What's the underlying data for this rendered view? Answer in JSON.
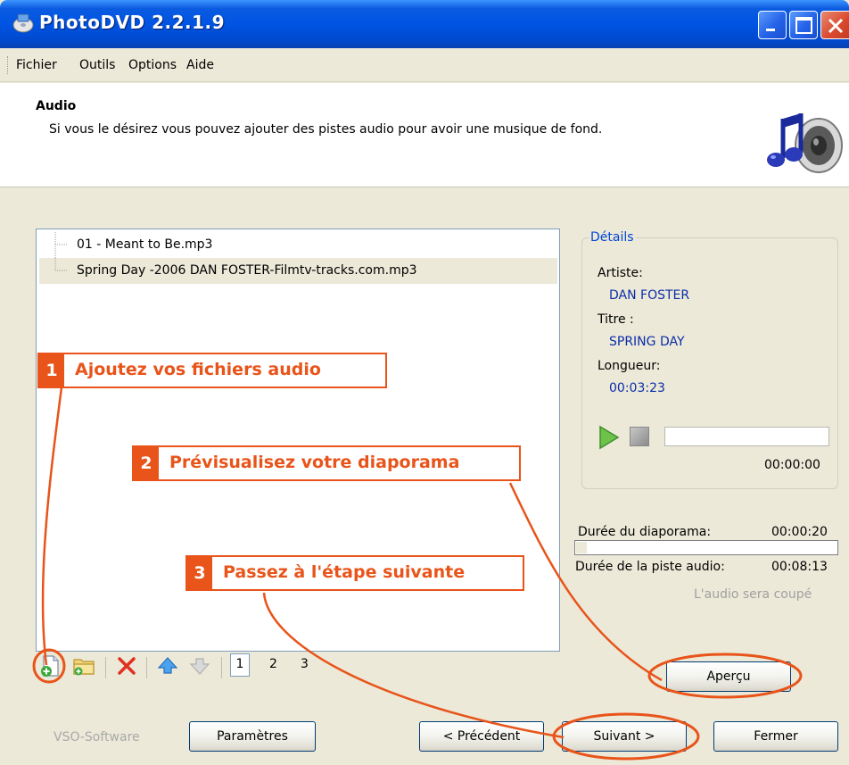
{
  "window": {
    "title": "PhotoDVD 2.2.1.9",
    "controls": [
      "minimize-icon",
      "maximize-icon",
      "close-icon"
    ]
  },
  "menu": {
    "items": [
      "Fichier",
      "Outils",
      "Options",
      "Aide"
    ]
  },
  "header": {
    "title": "Audio",
    "description": "Si vous le désirez vous pouvez ajouter des pistes audio pour avoir une musique de fond.",
    "icon": "music-speaker-icon"
  },
  "tracks": [
    {
      "name": "01 - Meant to Be.mp3",
      "selected": false
    },
    {
      "name": "Spring Day -2006 DAN FOSTER-Filmtv-tracks.com.mp3",
      "selected": true
    }
  ],
  "details": {
    "legend": "Détails",
    "artist_label": "Artiste:",
    "artist_value": "DAN FOSTER",
    "title_label": "Titre :",
    "title_value": "SPRING DAY",
    "length_label": "Longueur:",
    "length_value": "00:03:23",
    "player_time": "00:00:00",
    "player_progress": 0
  },
  "duration": {
    "slideshow_label": "Durée du diaporama:",
    "slideshow_value": "00:00:20",
    "slideshow_fraction": 0.04,
    "audio_label": "Durée de la piste audio:",
    "audio_value": "00:08:13",
    "note": "L'audio sera coupé"
  },
  "toolbar": {
    "icons": [
      "add-file-icon",
      "add-folder-icon",
      "delete-icon",
      "move-up-icon",
      "move-down-icon"
    ],
    "pages": [
      "1",
      "2",
      "3"
    ],
    "current_page": "1"
  },
  "buttons": {
    "preview": "Aperçu",
    "settings": "Paramètres",
    "previous": "< Précédent",
    "next": "Suivant >",
    "close": "Fermer"
  },
  "brand": "VSO-Software",
  "annotations": [
    {
      "number": "1",
      "text": "Ajoutez vos fichiers audio"
    },
    {
      "number": "2",
      "text": "Prévisualisez votre diaporama"
    },
    {
      "number": "3",
      "text": "Passez à l'étape suivante"
    }
  ],
  "colors": {
    "annotation": "#E8541A",
    "titlebar": "#0054E3",
    "detail_value": "#0b2ea8",
    "window_bg": "#ECE9D8"
  }
}
